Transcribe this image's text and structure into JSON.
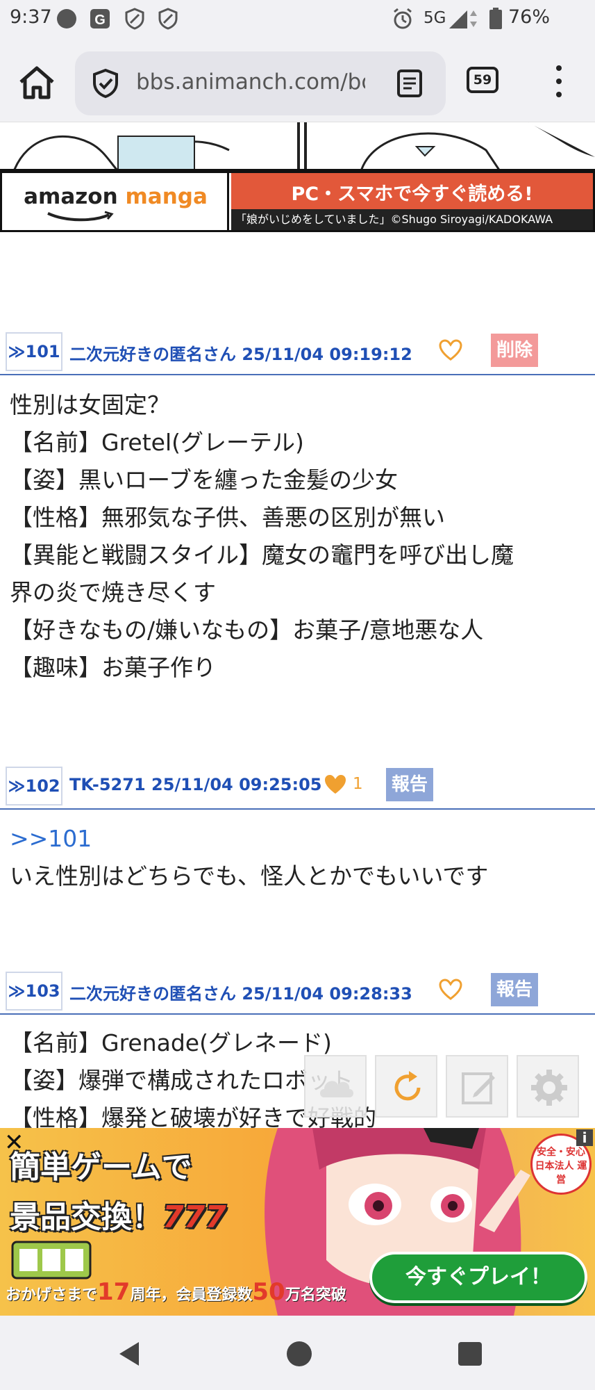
{
  "status_bar": {
    "time": "9:37",
    "network": "5G",
    "battery": "76%"
  },
  "browser": {
    "url": "bbs.animanch.com/bo",
    "tab_count": "59"
  },
  "ad_top": {
    "brand_word1": "amazon",
    "brand_word2": "manga",
    "headline": "PC・スマホで今すぐ読める!",
    "credit": "「娘がいじめをしていました」©Shugo Siroyagi/KADOKAWA"
  },
  "posts": [
    {
      "number": "≫101",
      "meta": "二次元好きの匿名さん 25/11/04 09:19:12",
      "likes": "",
      "action": "削除",
      "lines": [
        "性別は女固定？",
        "【名前】Gretel(グレーテル)",
        "【姿】黒いローブを纏った金髪の少女",
        "【性格】無邪気な子供、善悪の区別が無い",
        "【異能と戦闘スタイル】魔女の竈門を呼び出し魔",
        "界の炎で焼き尽くす",
        "【好きなもの/嫌いなもの】お菓子/意地悪な人",
        "【趣味】お菓子作り"
      ]
    },
    {
      "number": "≫102",
      "meta": "TK-5271 25/11/04 09:25:05",
      "likes": "1",
      "action": "報告",
      "quote": ">>101",
      "lines": [
        "いえ性別はどちらでも、怪人とかでもいいです"
      ]
    },
    {
      "number": "≫103",
      "meta": "二次元好きの匿名さん 25/11/04 09:28:33",
      "likes": "",
      "action": "報告",
      "lines": [
        "【名前】Grenade(グレネード)",
        "【姿】爆弾で構成されたロボット",
        "【性格】爆発と破壊が好きで好戦的"
      ]
    }
  ],
  "ad_bottom": {
    "line1": "簡単ゲームで",
    "line2_a": "景品交換！",
    "line2_b": "777",
    "badge": "安全・安心 日本法人 運営",
    "info": "i",
    "cta": "今すぐプレイ！",
    "footer_a": "おかげさまで",
    "footer_b": "17",
    "footer_c": "周年，会員登録数",
    "footer_d": "50",
    "footer_e": "万名突破",
    "close": "✕"
  }
}
